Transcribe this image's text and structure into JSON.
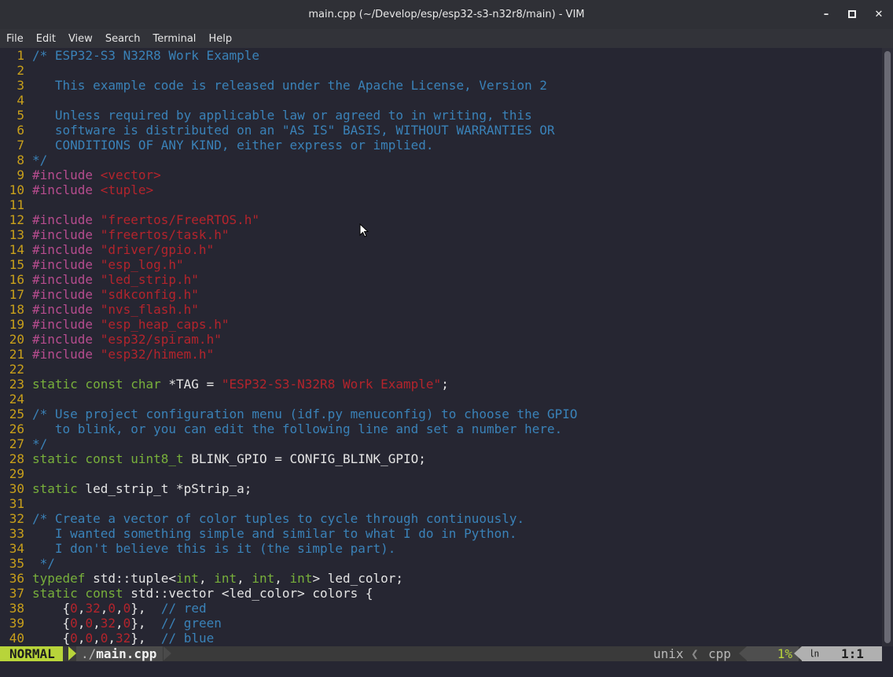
{
  "window": {
    "title": "main.cpp (~/Develop/esp/esp32-s3-n32r8/main) - VIM",
    "minimize_glyph": "–",
    "maximize_glyph": "□",
    "close_glyph": "✕"
  },
  "menubar": [
    "File",
    "Edit",
    "View",
    "Search",
    "Terminal",
    "Help"
  ],
  "editor": {
    "lines": [
      {
        "n": "1",
        "t": [
          [
            "c-cmt",
            "/* ESP32-S3 N32R8 Work Example"
          ]
        ]
      },
      {
        "n": "2",
        "t": [
          [
            "c-cmt",
            ""
          ]
        ]
      },
      {
        "n": "3",
        "t": [
          [
            "c-cmt",
            "   This example code is released under the Apache License, Version 2"
          ]
        ]
      },
      {
        "n": "4",
        "t": [
          [
            "c-cmt",
            ""
          ]
        ]
      },
      {
        "n": "5",
        "t": [
          [
            "c-cmt",
            "   Unless required by applicable law or agreed to in writing, this"
          ]
        ]
      },
      {
        "n": "6",
        "t": [
          [
            "c-cmt",
            "   software is distributed on an \"AS IS\" BASIS, WITHOUT WARRANTIES OR"
          ]
        ]
      },
      {
        "n": "7",
        "t": [
          [
            "c-cmt",
            "   CONDITIONS OF ANY KIND, either express or implied."
          ]
        ]
      },
      {
        "n": "8",
        "t": [
          [
            "c-cmt",
            "*/"
          ]
        ]
      },
      {
        "n": "9",
        "t": [
          [
            "c-pre",
            "#include "
          ],
          [
            "c-str",
            "<vector>"
          ]
        ]
      },
      {
        "n": "10",
        "t": [
          [
            "c-pre",
            "#include "
          ],
          [
            "c-str",
            "<tuple>"
          ]
        ]
      },
      {
        "n": "11",
        "t": []
      },
      {
        "n": "12",
        "t": [
          [
            "c-pre",
            "#include "
          ],
          [
            "c-str",
            "\"freertos/FreeRTOS.h\""
          ]
        ]
      },
      {
        "n": "13",
        "t": [
          [
            "c-pre",
            "#include "
          ],
          [
            "c-str",
            "\"freertos/task.h\""
          ]
        ]
      },
      {
        "n": "14",
        "t": [
          [
            "c-pre",
            "#include "
          ],
          [
            "c-str",
            "\"driver/gpio.h\""
          ]
        ]
      },
      {
        "n": "15",
        "t": [
          [
            "c-pre",
            "#include "
          ],
          [
            "c-str",
            "\"esp_log.h\""
          ]
        ]
      },
      {
        "n": "16",
        "t": [
          [
            "c-pre",
            "#include "
          ],
          [
            "c-str",
            "\"led_strip.h\""
          ]
        ]
      },
      {
        "n": "17",
        "t": [
          [
            "c-pre",
            "#include "
          ],
          [
            "c-str",
            "\"sdkconfig.h\""
          ]
        ]
      },
      {
        "n": "18",
        "t": [
          [
            "c-pre",
            "#include "
          ],
          [
            "c-str",
            "\"nvs_flash.h\""
          ]
        ]
      },
      {
        "n": "19",
        "t": [
          [
            "c-pre",
            "#include "
          ],
          [
            "c-str",
            "\"esp_heap_caps.h\""
          ]
        ]
      },
      {
        "n": "20",
        "t": [
          [
            "c-pre",
            "#include "
          ],
          [
            "c-str",
            "\"esp32/spiram.h\""
          ]
        ]
      },
      {
        "n": "21",
        "t": [
          [
            "c-pre",
            "#include "
          ],
          [
            "c-str",
            "\"esp32/himem.h\""
          ]
        ]
      },
      {
        "n": "22",
        "t": []
      },
      {
        "n": "23",
        "t": [
          [
            "c-kw",
            "static const char"
          ],
          [
            "c-id",
            " *TAG = "
          ],
          [
            "c-str",
            "\"ESP32-S3-N32R8 Work Example\""
          ],
          [
            "c-id",
            ";"
          ]
        ]
      },
      {
        "n": "24",
        "t": []
      },
      {
        "n": "25",
        "t": [
          [
            "c-cmt",
            "/* Use project configuration menu (idf.py menuconfig) to choose the GPIO"
          ]
        ]
      },
      {
        "n": "26",
        "t": [
          [
            "c-cmt",
            "   to blink, or you can edit the following line and set a number here."
          ]
        ]
      },
      {
        "n": "27",
        "t": [
          [
            "c-cmt",
            "*/"
          ]
        ]
      },
      {
        "n": "28",
        "t": [
          [
            "c-kw",
            "static const uint8_t"
          ],
          [
            "c-id",
            " BLINK_GPIO = CONFIG_BLINK_GPIO;"
          ]
        ]
      },
      {
        "n": "29",
        "t": []
      },
      {
        "n": "30",
        "t": [
          [
            "c-kw",
            "static"
          ],
          [
            "c-id",
            " led_strip_t *pStrip_a;"
          ]
        ]
      },
      {
        "n": "31",
        "t": []
      },
      {
        "n": "32",
        "t": [
          [
            "c-cmt",
            "/* Create a vector of color tuples to cycle through continuously."
          ]
        ]
      },
      {
        "n": "33",
        "t": [
          [
            "c-cmt",
            "   I wanted something simple and similar to what I do in Python."
          ]
        ]
      },
      {
        "n": "34",
        "t": [
          [
            "c-cmt",
            "   I don't believe this is it (the simple part)."
          ]
        ]
      },
      {
        "n": "35",
        "t": [
          [
            "c-cmt",
            " */"
          ]
        ]
      },
      {
        "n": "36",
        "t": [
          [
            "c-kw",
            "typedef"
          ],
          [
            "c-id",
            " std::tuple<"
          ],
          [
            "c-kw",
            "int"
          ],
          [
            "c-id",
            ", "
          ],
          [
            "c-kw",
            "int"
          ],
          [
            "c-id",
            ", "
          ],
          [
            "c-kw",
            "int"
          ],
          [
            "c-id",
            ", "
          ],
          [
            "c-kw",
            "int"
          ],
          [
            "c-id",
            "> led_color;"
          ]
        ]
      },
      {
        "n": "37",
        "t": [
          [
            "c-kw",
            "static const"
          ],
          [
            "c-id",
            " std::vector <led_color> colors {"
          ]
        ]
      },
      {
        "n": "38",
        "t": [
          [
            "c-id",
            "    {"
          ],
          [
            "c-num",
            "0"
          ],
          [
            "c-id",
            ","
          ],
          [
            "c-num",
            "32"
          ],
          [
            "c-id",
            ","
          ],
          [
            "c-num",
            "0"
          ],
          [
            "c-id",
            ","
          ],
          [
            "c-num",
            "0"
          ],
          [
            "c-id",
            "},  "
          ],
          [
            "c-cmt",
            "// red"
          ]
        ]
      },
      {
        "n": "39",
        "t": [
          [
            "c-id",
            "    {"
          ],
          [
            "c-num",
            "0"
          ],
          [
            "c-id",
            ","
          ],
          [
            "c-num",
            "0"
          ],
          [
            "c-id",
            ","
          ],
          [
            "c-num",
            "32"
          ],
          [
            "c-id",
            ","
          ],
          [
            "c-num",
            "0"
          ],
          [
            "c-id",
            "},  "
          ],
          [
            "c-cmt",
            "// green"
          ]
        ]
      },
      {
        "n": "40",
        "t": [
          [
            "c-id",
            "    {"
          ],
          [
            "c-num",
            "0"
          ],
          [
            "c-id",
            ","
          ],
          [
            "c-num",
            "0"
          ],
          [
            "c-id",
            ","
          ],
          [
            "c-num",
            "0"
          ],
          [
            "c-id",
            ","
          ],
          [
            "c-num",
            "32"
          ],
          [
            "c-id",
            "},  "
          ],
          [
            "c-cmt",
            "// blue"
          ]
        ]
      }
    ]
  },
  "statusline": {
    "mode": "NORMAL",
    "file_prefix": "./",
    "file_name": "main.cpp",
    "fileformat": "unix",
    "separator": "❮",
    "filetype": "cpp",
    "percent": "1%",
    "ln_icon": "㏑",
    "position": "1:1"
  }
}
